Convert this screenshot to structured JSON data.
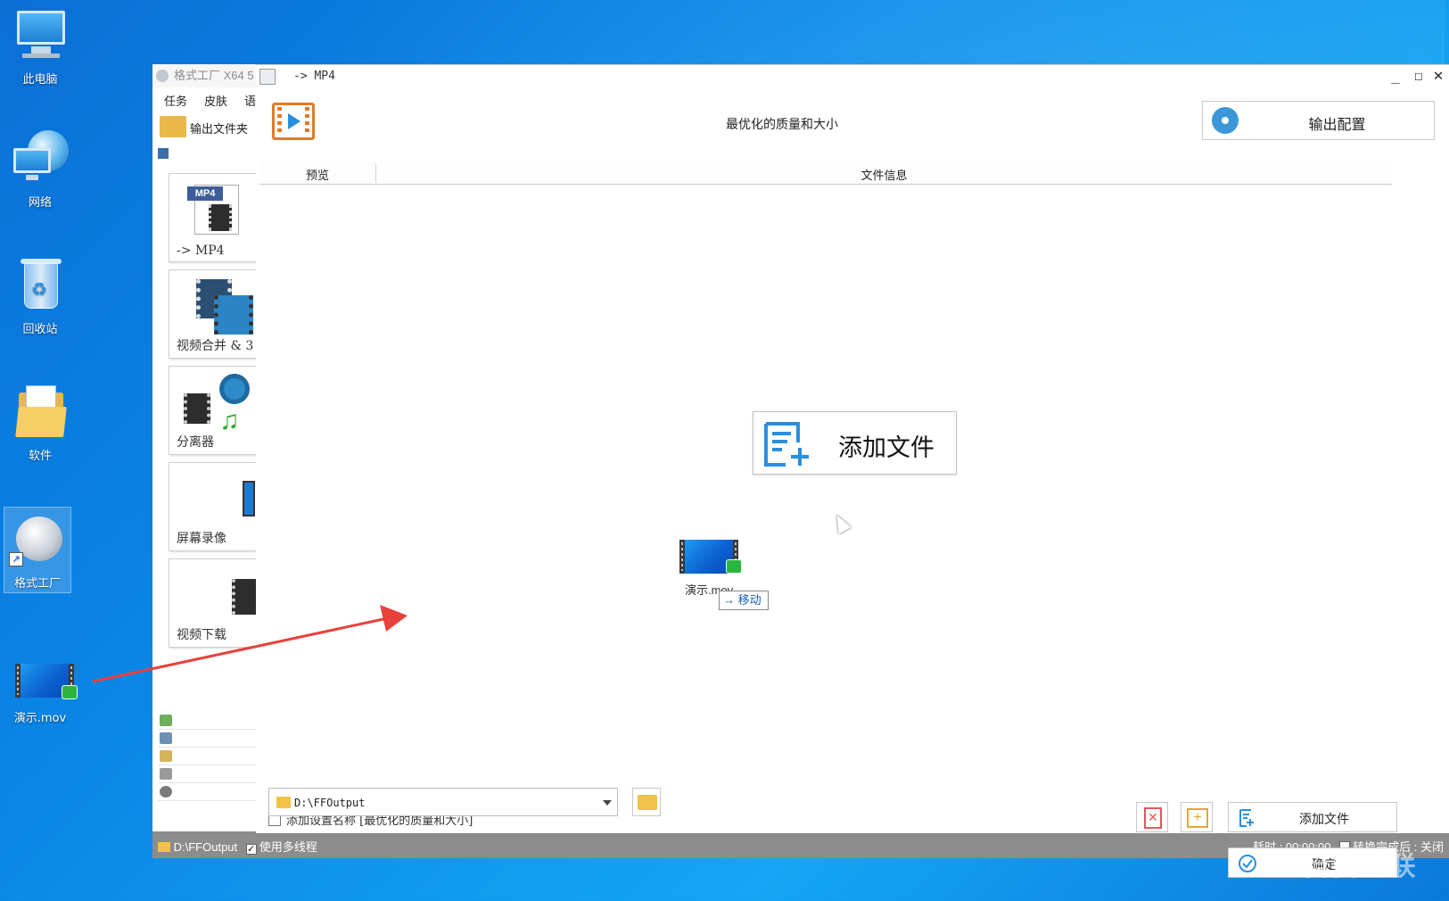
{
  "desktop": {
    "icons": [
      {
        "label": "此电脑",
        "icon": "computer-icon"
      },
      {
        "label": "网络",
        "icon": "network-icon"
      },
      {
        "label": "回收站",
        "icon": "recycle-bin-icon"
      },
      {
        "label": "软件",
        "icon": "folder-icon"
      },
      {
        "label": "格式工厂",
        "icon": "format-factory-icon"
      },
      {
        "label": "演示.mov",
        "icon": "video-file-icon"
      }
    ]
  },
  "app": {
    "title": "格式工厂 X64 5",
    "menu": [
      "任务",
      "皮肤",
      "语"
    ],
    "toolbar_output_folder": "输出文件夹",
    "tiles": [
      {
        "label": "-> MP4"
      },
      {
        "label": "视频合并 & 3"
      },
      {
        "label": "分离器"
      },
      {
        "label": "屏幕录像"
      },
      {
        "label": "视频下载"
      }
    ],
    "status": {
      "path": "D:\\FFOutput",
      "multithread_label": "使用多线程",
      "multithread_checked": true,
      "elapsed": "耗时 : 00:00:00",
      "after_done": "转换完成后 : 关闭"
    }
  },
  "dialog": {
    "title": "-> MP4",
    "quality": "最优化的质量和大小",
    "output_config": "输出配置",
    "columns": [
      "预览",
      "文件信息"
    ],
    "add_file_big": "添加文件",
    "drag": {
      "filename": "演示.mov",
      "action": "移动"
    },
    "add_setting_name": "添加设置名称 [最优化的质量和大小]",
    "add_file_button": "添加文件",
    "ok_button": "确定",
    "output_path": "D:\\FFOutput"
  },
  "watermark": "自由互联",
  "colors": {
    "accent_blue": "#2a8ede",
    "accent_orange": "#e07b2c",
    "arrow_red": "#e8413c"
  }
}
